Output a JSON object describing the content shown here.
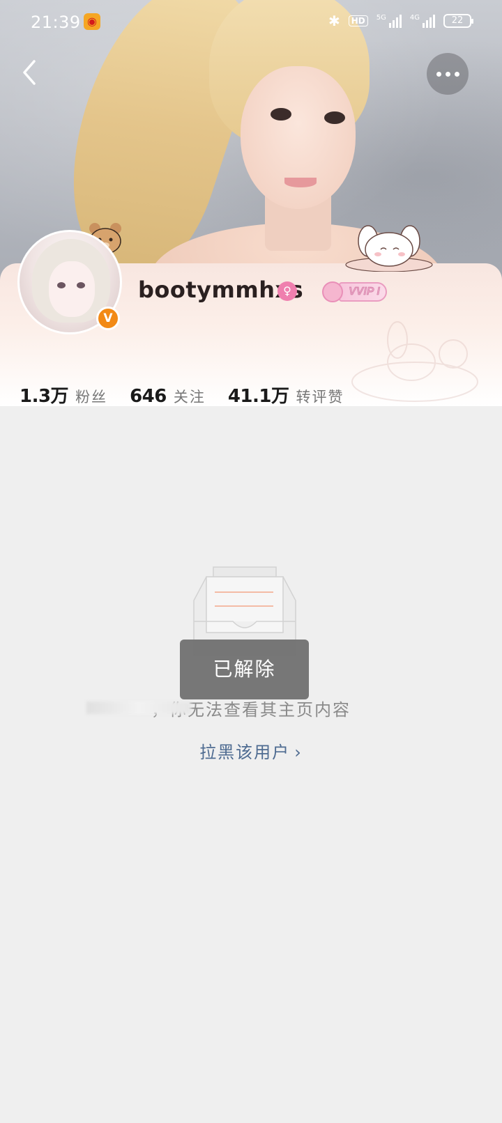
{
  "status_bar": {
    "time": "21:39",
    "network_1": "5G",
    "network_2": "4G",
    "hd": "HD",
    "battery": "22"
  },
  "icons": {
    "back": "back-arrow-icon",
    "more": "more-dots-icon",
    "verified": "verified-v-icon",
    "gender": "female-icon",
    "app_notification": "weibo-icon"
  },
  "profile": {
    "username": "bootymmhxs",
    "verified_mark": "V",
    "vip_label": "VVIP I",
    "stats": [
      {
        "value": "1.3万",
        "label": "粉丝"
      },
      {
        "value": "646",
        "label": "关注"
      },
      {
        "value": "41.1万",
        "label": "转评赞"
      }
    ]
  },
  "empty_state": {
    "message": "，你无法查看其主页内容",
    "block_link": "拉黑该用户",
    "block_chevron": "›"
  },
  "toast": {
    "text": "已解除"
  },
  "colors": {
    "page_bg": "#efefef",
    "link": "#4e6b91",
    "verified": "#f28a16",
    "gender": "#ef7fae",
    "toast_bg": "#707070"
  }
}
